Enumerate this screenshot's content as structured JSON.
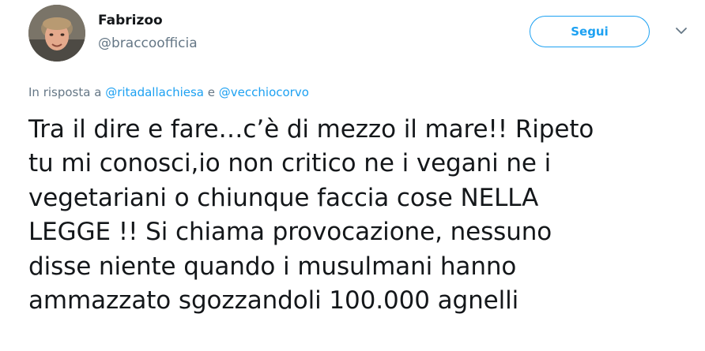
{
  "user": {
    "display_name": "Fabrizoo",
    "handle": "@braccoofficia"
  },
  "actions": {
    "follow_label": "Segui",
    "menu_icon": "chevron-down-icon"
  },
  "reply_context": {
    "prefix": "In risposta a",
    "mention_1": "@ritadallachiesa",
    "conjunction": "e",
    "mention_2": "@vecchiocorvo"
  },
  "tweet": {
    "lines": [
      "Tra il dire e fare…c’è di mezzo il mare!! Ripeto",
      "tu mi conosci,io non critico ne i vegani ne i",
      "vegetariani o chiunque faccia cose NELLA",
      "LEGGE !! Si chiama provocazione, nessuno",
      "disse niente quando i musulmani hanno",
      "ammazzato sgozzandoli 100.000 agnelli"
    ]
  },
  "colors": {
    "accent": "#1da1f2",
    "text": "#14171a",
    "secondary": "#657786"
  }
}
